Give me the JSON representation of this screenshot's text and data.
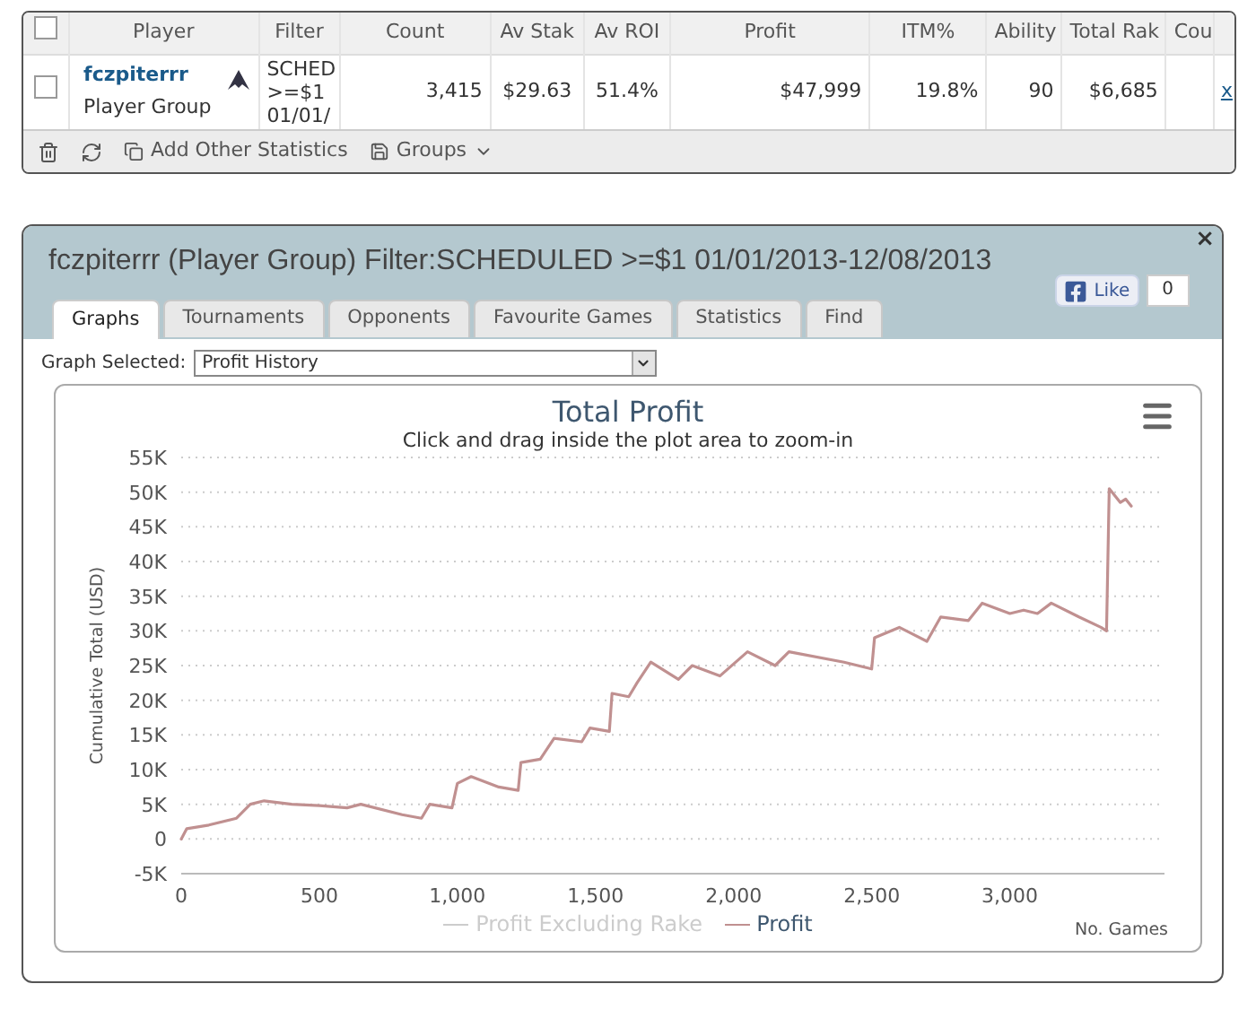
{
  "table": {
    "columns": [
      "Player",
      "Filter",
      "Count",
      "Av Stak",
      "Av ROI",
      "Profit",
      "ITM%",
      "Ability",
      "Total Rak",
      "Cou"
    ],
    "rows": [
      {
        "checked": false,
        "player": "fczpiterrr",
        "group": "Player Group",
        "filter_lines": [
          "SCHED",
          ">=$1",
          "01/01/"
        ],
        "count": "3,415",
        "av_stake": "$29.63",
        "av_roi": "51.4%",
        "profit": "$47,999",
        "itm": "19.8%",
        "ability": "90",
        "total_rake": "$6,685",
        "remove": "x"
      }
    ],
    "header_checked": false,
    "toolbar": {
      "add": "Add Other Statistics",
      "groups": "Groups"
    }
  },
  "panel": {
    "title": "fczpiterrr (Player Group) Filter:SCHEDULED >=$1 01/01/2013-12/08/2013",
    "close": "×",
    "like": "Like",
    "like_count": "0",
    "tabs": [
      {
        "label": "Graphs",
        "selected": true
      },
      {
        "label": "Tournaments",
        "selected": false
      },
      {
        "label": "Opponents",
        "selected": false
      },
      {
        "label": "Favourite Games",
        "selected": false
      },
      {
        "label": "Statistics",
        "selected": false
      },
      {
        "label": "Find",
        "selected": false
      }
    ],
    "graph_label": "Graph Selected:",
    "graph_value": "Profit History",
    "subtitle": "Click and drag inside the plot area to zoom-in",
    "hidden_series": [
      {
        "name": "Profit Excluding Rake",
        "active": false,
        "color": "#cccccc"
      }
    ],
    "chart_data": {
      "type": "line",
      "grid": true,
      "title": "Total Profit",
      "xlabel": "No. Games",
      "ylabel": "Cumulative Total (USD)",
      "x": [
        0,
        20,
        100,
        200,
        250,
        300,
        400,
        500,
        600,
        650,
        800,
        870,
        900,
        980,
        1000,
        1050,
        1150,
        1220,
        1230,
        1300,
        1350,
        1450,
        1480,
        1550,
        1560,
        1620,
        1650,
        1700,
        1800,
        1850,
        1950,
        2050,
        2150,
        2200,
        2400,
        2500,
        2510,
        2600,
        2700,
        2750,
        2850,
        2900,
        3000,
        3050,
        3100,
        3150,
        3250,
        3330,
        3350,
        3360,
        3400,
        3420,
        3440
      ],
      "series": [
        {
          "name": "Profit",
          "color": "#c09090",
          "values": [
            0,
            1500,
            2000,
            3000,
            5000,
            5500,
            5000,
            4800,
            4500,
            5000,
            3500,
            3000,
            5000,
            4500,
            8000,
            9000,
            7500,
            7000,
            11000,
            11500,
            14500,
            14000,
            16000,
            15500,
            21000,
            20500,
            22500,
            25500,
            23000,
            25000,
            23500,
            27000,
            25000,
            27000,
            25500,
            24500,
            29000,
            30500,
            28500,
            32000,
            31500,
            34000,
            32500,
            33000,
            32500,
            34000,
            32000,
            30500,
            30000,
            50500,
            48500,
            49000,
            48000
          ]
        }
      ],
      "xlim": [
        0,
        3560
      ],
      "ylim": [
        -5000,
        55000
      ],
      "xticks": [
        {
          "value": 0,
          "label": "0"
        },
        {
          "value": 500,
          "label": "500"
        },
        {
          "value": 1000,
          "label": "1,000"
        },
        {
          "value": 1500,
          "label": "1,500"
        },
        {
          "value": 2000,
          "label": "2,000"
        },
        {
          "value": 2500,
          "label": "2,500"
        },
        {
          "value": 3000,
          "label": "3,000"
        }
      ],
      "yticks": [
        {
          "value": -5000,
          "label": "-5K"
        },
        {
          "value": 0,
          "label": "0"
        },
        {
          "value": 5000,
          "label": "5K"
        },
        {
          "value": 10000,
          "label": "10K"
        },
        {
          "value": 15000,
          "label": "15K"
        },
        {
          "value": 20000,
          "label": "20K"
        },
        {
          "value": 25000,
          "label": "25K"
        },
        {
          "value": 30000,
          "label": "30K"
        },
        {
          "value": 35000,
          "label": "35K"
        },
        {
          "value": 40000,
          "label": "40K"
        },
        {
          "value": 45000,
          "label": "45K"
        },
        {
          "value": 50000,
          "label": "50K"
        },
        {
          "value": 55000,
          "label": "55K"
        }
      ]
    }
  }
}
